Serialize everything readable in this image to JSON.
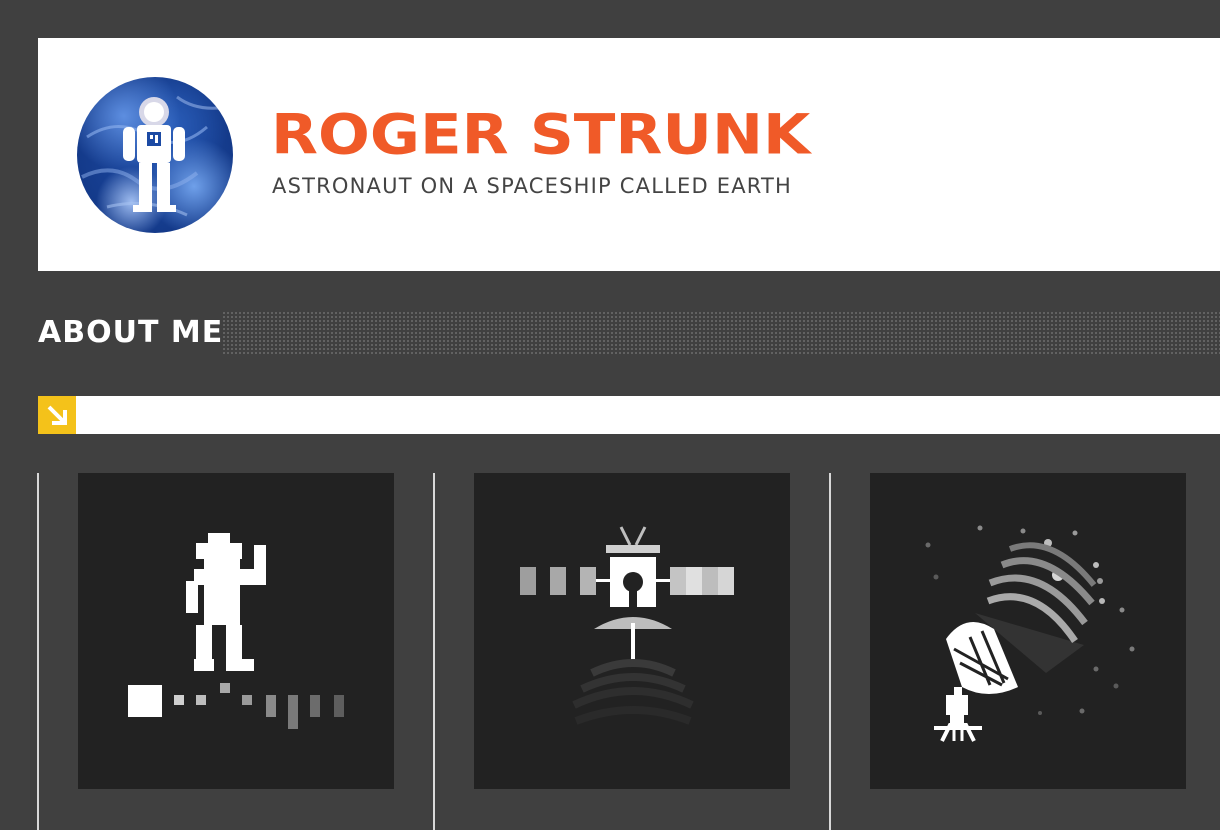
{
  "header": {
    "site_title": "ROGER STRUNK",
    "tagline": "ASTRONAUT ON A SPACESHIP CALLED EARTH",
    "logo": {
      "icon": "astronaut-on-globe-icon",
      "accent": "#f05a28"
    }
  },
  "section": {
    "title": "ABOUT ME"
  },
  "ribbon": {
    "badge_icon": "arrow-down-right-icon",
    "badge_color": "#f4c21a"
  },
  "tiles": [
    {
      "icon": "pixel-astronaut-waving-icon"
    },
    {
      "icon": "satellite-icon"
    },
    {
      "icon": "radio-telescope-icon"
    }
  ],
  "colors": {
    "background": "#404040",
    "header_bg": "#ffffff",
    "title": "#f05a28",
    "tagline": "#444444",
    "tile_bg": "#222222"
  }
}
